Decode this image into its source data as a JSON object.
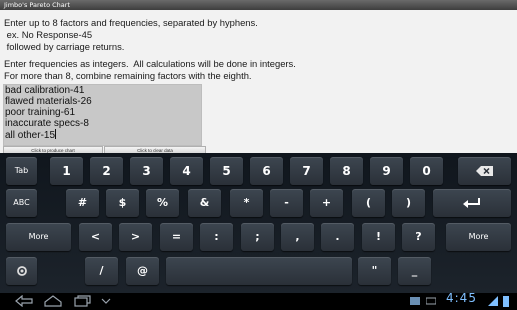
{
  "app": {
    "title": "Jimbo's Pareto Chart"
  },
  "instructions": {
    "line1": "Enter up to 8 factors and frequencies, separated by hyphens.",
    "line2": " ex. No Response-45",
    "line3": " followed by carriage returns.",
    "line4": "Enter frequencies as integers.  All calculations will be done in integers.",
    "line5": "For more than 8, combine remaining factors with the eighth."
  },
  "entry": {
    "lines": [
      "bad calibration-41",
      "flawed materials-26",
      "poor training-61",
      "inaccurate specs-8",
      "all other-15"
    ]
  },
  "buttons": {
    "produce_chart": "Click to produce chart",
    "clear_data": "Click to clear data"
  },
  "keyboard": {
    "row1": [
      "Tab",
      "1",
      "2",
      "3",
      "4",
      "5",
      "6",
      "7",
      "8",
      "9",
      "0",
      "backspace-icon"
    ],
    "row2": [
      "ABC",
      "#",
      "$",
      "%",
      "&",
      "*",
      "-",
      "+",
      "(",
      ")",
      "enter-icon"
    ],
    "row3": [
      "More",
      "<",
      ">",
      "=",
      ":",
      ";",
      ",",
      ".",
      "!",
      "?",
      "More"
    ],
    "row4": [
      "settings-icon",
      "/",
      "@",
      "space",
      "\"",
      "_"
    ],
    "labels": {
      "tab": "Tab",
      "abc": "ABC",
      "more_left": "More",
      "more_right": "More",
      "k1": "1",
      "k2": "2",
      "k3": "3",
      "k4": "4",
      "k5": "5",
      "k6": "6",
      "k7": "7",
      "k8": "8",
      "k9": "9",
      "k0": "0",
      "hash": "#",
      "dollar": "$",
      "percent": "%",
      "amp": "&",
      "star": "*",
      "minus": "-",
      "plus": "+",
      "lparen": "(",
      "rparen": ")",
      "lt": "<",
      "gt": ">",
      "eq": "=",
      "colon": ":",
      "semi": ";",
      "comma": ",",
      "dot": ".",
      "excl": "!",
      "quest": "?",
      "slash": "/",
      "at": "@",
      "quote": "\"",
      "underscore": "_"
    }
  },
  "status_bar": {
    "time": "4:45"
  },
  "colors": {
    "keyboard_bg": "#161c23",
    "key": "#353d46",
    "clock": "#7fbfff",
    "entry_bg": "#c8c8c8"
  }
}
